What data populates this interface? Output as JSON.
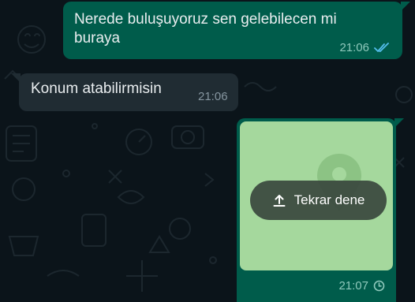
{
  "conversation": {
    "messages": [
      {
        "direction": "outgoing",
        "text": "Nerede buluşuyoruz sen gelebilecen mi buraya",
        "time": "21:06",
        "status_icon": "double-check-read-icon"
      },
      {
        "direction": "incoming",
        "text": "Konum atabilirmisin",
        "time": "21:06"
      },
      {
        "direction": "outgoing",
        "type": "location",
        "retry_label": "Tekrar dene",
        "time": "21:07",
        "status_icon": "clock-pending-icon"
      }
    ]
  },
  "colors": {
    "chat_background": "#0b141a",
    "outgoing_bubble": "#005c4b",
    "incoming_bubble": "#202c33",
    "map_preview": "#a5d89d",
    "read_ticks": "#53bdeb"
  }
}
